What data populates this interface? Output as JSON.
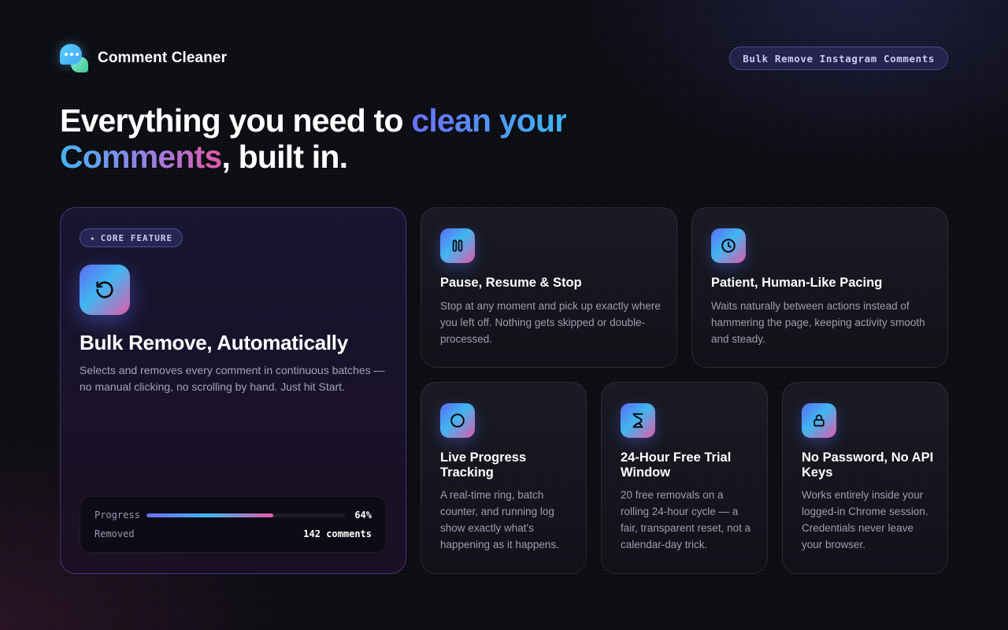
{
  "brand": {
    "name": "Comment Cleaner",
    "logo_icon": "chat-bubbles-icon"
  },
  "header": {
    "pill_label": "Bulk Remove Instagram Comments"
  },
  "headline": {
    "part1": "Everything you need to ",
    "accent1": "clean your",
    "accent2": "Comments",
    "part2": ", built in."
  },
  "core_feature": {
    "badge_icon": "✦",
    "badge_label": "CORE FEATURE",
    "icon": "refresh-icon",
    "title": "Bulk Remove, Automatically",
    "description": "Selects and removes every comment in continuous batches — no manual clicking, no scrolling by hand. Just hit Start.",
    "progress": {
      "label": "Progress",
      "fraction": 0.64,
      "percent_text": "64%",
      "removed_label": "Removed",
      "removed_value": "142 comments"
    }
  },
  "features": [
    {
      "icon": "pause-icon",
      "title": "Pause, Resume & Stop",
      "description": "Stop at any moment and pick up exactly where you left off. Nothing gets skipped or double-processed."
    },
    {
      "icon": "clock-icon",
      "title": "Patient, Human-Like Pacing",
      "description": "Waits naturally between actions instead of hammering the page, keeping activity smooth and steady."
    },
    {
      "icon": "ring-icon",
      "title": "Live Progress Tracking",
      "description": "A real-time ring, batch counter, and running log show exactly what's happening as it happens."
    },
    {
      "icon": "hourglass-icon",
      "title": "24-Hour Free Trial Window",
      "description": "20 free removals on a rolling 24-hour cycle — a fair, transparent reset, not a calendar-day trick."
    },
    {
      "icon": "lock-icon",
      "title": "No Password, No API Keys",
      "description": "Works entirely inside your logged-in Chrome session. Credentials never leave your browser."
    }
  ],
  "colors": {
    "accent_blue": "#41b6f0",
    "accent_indigo": "#6b6ff5",
    "accent_pink": "#e15aa9",
    "background": "#0b0b12"
  }
}
